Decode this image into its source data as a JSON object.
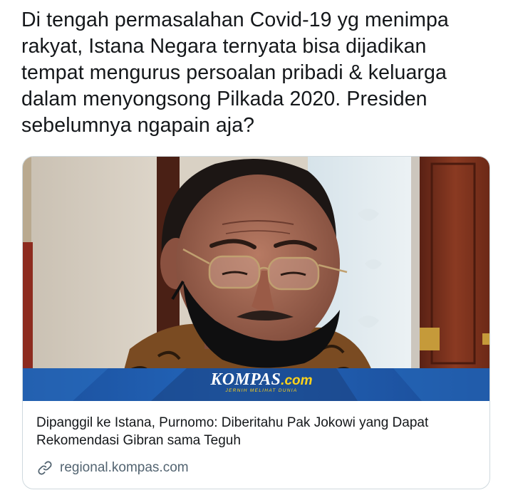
{
  "tweet": {
    "text": "Di tengah permasalahan Covid-19 yg menimpa rakyat, Istana Negara ternyata bisa dijadikan tempat mengurus persoalan pribadi & keluarga dalam menyongsong Pilkada 2020. Presiden sebelumnya ngapain aja?"
  },
  "card": {
    "image_brand": {
      "name": "KOMPAS",
      "suffix": ".com",
      "tagline": "JERNIH MELIHAT DUNIA"
    },
    "title": "Dipanggil ke Istana, Purnomo: Diberitahu Pak Jokowi yang Dapat Rekomendasi Gibran sama Teguh",
    "domain": "regional.kompas.com",
    "domain_icon": "link-icon"
  },
  "colors": {
    "text_primary": "#14171a",
    "text_secondary": "#536471",
    "card_border": "#cfd9de",
    "brand_blue": "#1d56a8",
    "brand_yellow": "#ffd31a"
  }
}
